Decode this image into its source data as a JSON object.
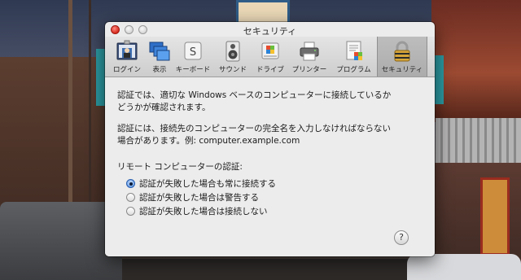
{
  "window": {
    "title": "セキュリティ"
  },
  "toolbar": {
    "items": [
      {
        "label": "ログイン",
        "icon": "login-icon"
      },
      {
        "label": "表示",
        "icon": "display-icon"
      },
      {
        "label": "キーボード",
        "icon": "keyboard-icon"
      },
      {
        "label": "サウンド",
        "icon": "sound-icon"
      },
      {
        "label": "ドライブ",
        "icon": "drive-icon"
      },
      {
        "label": "プリンター",
        "icon": "printer-icon"
      },
      {
        "label": "プログラム",
        "icon": "program-icon"
      },
      {
        "label": "セキュリティ",
        "icon": "security-lock-icon",
        "selected": true
      }
    ]
  },
  "content": {
    "para1_line1": "認証では、適切な Windows ベースのコンピューターに接続しているか",
    "para1_line2": "どうかが確認されます。",
    "para2_line1": "認証には、接続先のコンピューターの完全名を入力しなければならない",
    "para2_line2": "場合があります。例: computer.example.com",
    "section_label": "リモート コンピューターの認証:",
    "options": [
      {
        "label": "認証が失敗した場合も常に接続する",
        "checked": true
      },
      {
        "label": "認証が失敗した場合は警告する",
        "checked": false
      },
      {
        "label": "認証が失敗した場合は接続しない",
        "checked": false
      }
    ],
    "help_label": "?"
  },
  "colors": {
    "selected_radio": "#3c74c6",
    "close_button": "#d7281c",
    "window_bg": "#ececec"
  }
}
